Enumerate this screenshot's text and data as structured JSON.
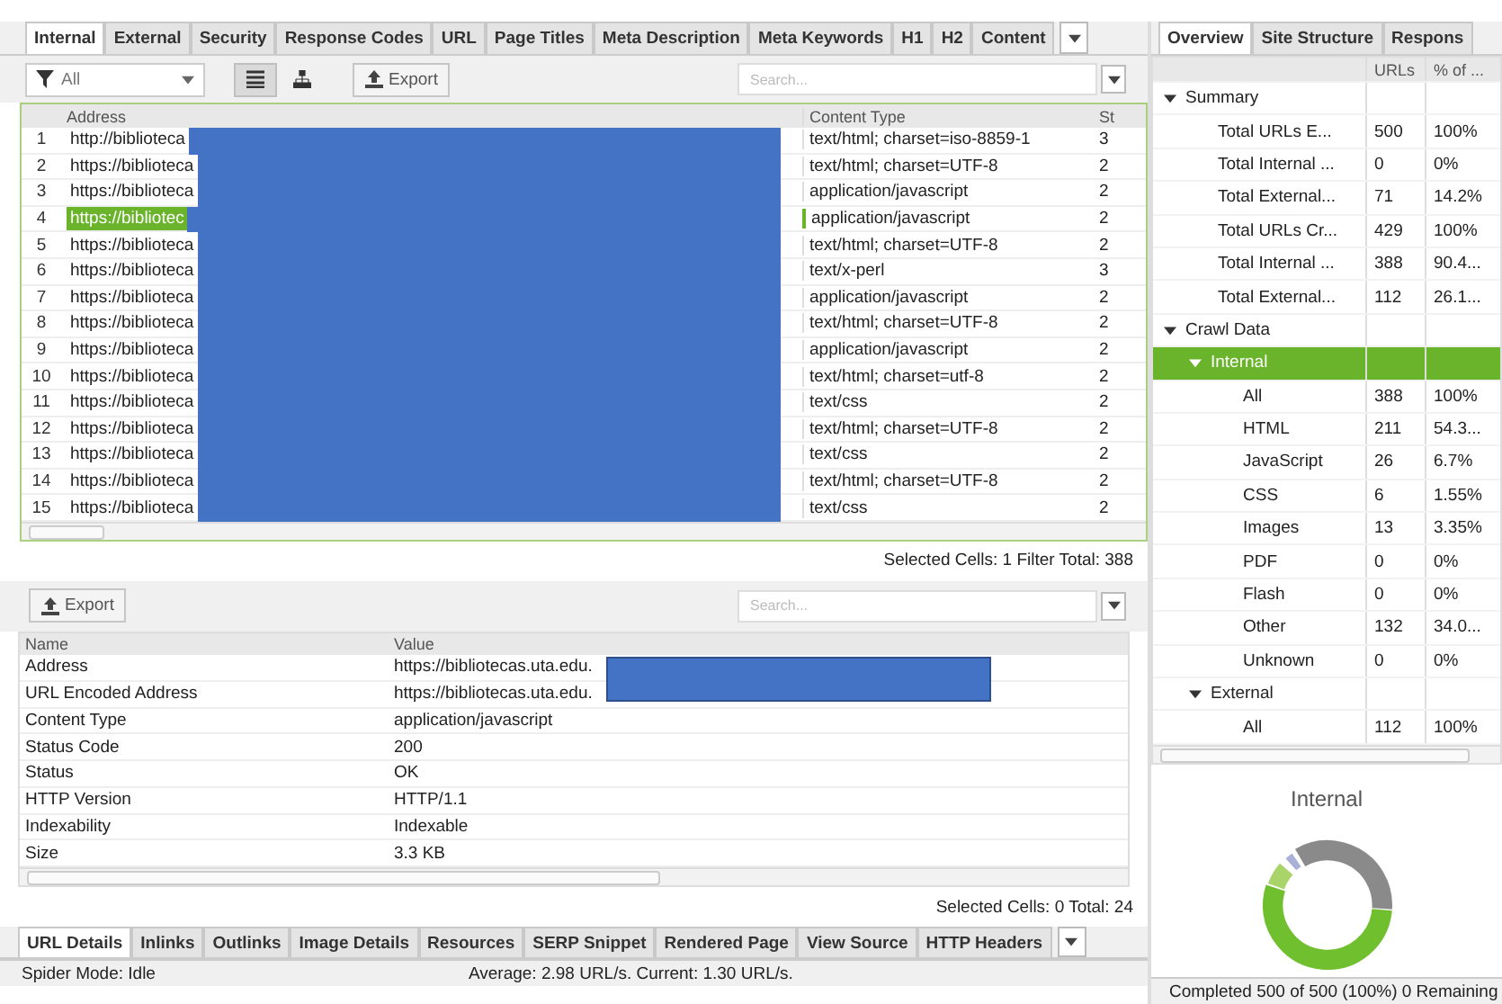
{
  "main_tabs": [
    {
      "label": "Internal",
      "selected": true
    },
    {
      "label": "External",
      "selected": false
    },
    {
      "label": "Security",
      "selected": false
    },
    {
      "label": "Response Codes",
      "selected": false
    },
    {
      "label": "URL",
      "selected": false
    },
    {
      "label": "Page Titles",
      "selected": false
    },
    {
      "label": "Meta Description",
      "selected": false
    },
    {
      "label": "Meta Keywords",
      "selected": false
    },
    {
      "label": "H1",
      "selected": false
    },
    {
      "label": "H2",
      "selected": false
    },
    {
      "label": "Content",
      "selected": false
    }
  ],
  "toolbar": {
    "filter": "All",
    "views": [
      {
        "kind": "list",
        "selected": true
      },
      {
        "kind": "tree",
        "selected": false
      }
    ],
    "export": "Export",
    "search": {
      "placeholder": "Search..."
    }
  },
  "table": {
    "columns": [
      "Address",
      "Content Type",
      "St"
    ],
    "rows": [
      {
        "index": "1",
        "address": "http://biblioteca",
        "content_type": "text/html; charset=iso-8859-1",
        "column_3": "3",
        "selected": false
      },
      {
        "index": "2",
        "address": "https://biblioteca",
        "content_type": "text/html; charset=UTF-8",
        "column_3": "2",
        "selected": false
      },
      {
        "index": "3",
        "address": "https://biblioteca",
        "content_type": "application/javascript",
        "column_3": "2",
        "selected": false
      },
      {
        "index": "4",
        "address": "https://bibliotec",
        "content_type": "application/javascript",
        "column_3": "2",
        "selected": true
      },
      {
        "index": "5",
        "address": "https://biblioteca",
        "content_type": "text/html; charset=UTF-8",
        "column_3": "2",
        "selected": false
      },
      {
        "index": "6",
        "address": "https://biblioteca",
        "content_type": "text/x-perl",
        "column_3": "3",
        "selected": false
      },
      {
        "index": "7",
        "address": "https://biblioteca",
        "content_type": "application/javascript",
        "column_3": "2",
        "selected": false
      },
      {
        "index": "8",
        "address": "https://biblioteca",
        "content_type": "text/html; charset=UTF-8",
        "column_3": "2",
        "selected": false
      },
      {
        "index": "9",
        "address": "https://biblioteca",
        "content_type": "application/javascript",
        "column_3": "2",
        "selected": false
      },
      {
        "index": "10",
        "address": "https://biblioteca",
        "content_type": "text/html; charset=utf-8",
        "column_3": "2",
        "selected": false
      },
      {
        "index": "11",
        "address": "https://biblioteca",
        "content_type": "text/css",
        "column_3": "2",
        "selected": false
      },
      {
        "index": "12",
        "address": "https://biblioteca",
        "content_type": "text/html; charset=UTF-8",
        "column_3": "2",
        "selected": false
      },
      {
        "index": "13",
        "address": "https://biblioteca",
        "content_type": "text/css",
        "column_3": "2",
        "selected": false
      },
      {
        "index": "14",
        "address": "https://biblioteca",
        "content_type": "text/html; charset=UTF-8",
        "column_3": "2",
        "selected": false
      },
      {
        "index": "15",
        "address": "https://biblioteca",
        "content_type": "text/css",
        "column_3": "2",
        "selected": false
      }
    ],
    "footer": "Selected Cells: 1  Filter Total: 388"
  },
  "details": {
    "export": "Export",
    "search": {
      "placeholder": "Search..."
    },
    "columns": [
      "Name",
      "Value"
    ],
    "rows": [
      {
        "name": "Address",
        "value": "https://bibliotecas.uta.edu."
      },
      {
        "name": "URL Encoded Address",
        "value": "https://bibliotecas.uta.edu."
      },
      {
        "name": "Content Type",
        "value": "application/javascript"
      },
      {
        "name": "Status Code",
        "value": "200"
      },
      {
        "name": "Status",
        "value": "OK"
      },
      {
        "name": "HTTP Version",
        "value": "HTTP/1.1"
      },
      {
        "name": "Indexability",
        "value": "Indexable"
      },
      {
        "name": "Size",
        "value": "3.3 KB"
      }
    ],
    "footer": "Selected Cells: 0  Total: 24"
  },
  "bottom_tabs": [
    {
      "label": "URL Details",
      "selected": true
    },
    {
      "label": "Inlinks",
      "selected": false
    },
    {
      "label": "Outlinks",
      "selected": false
    },
    {
      "label": "Image Details",
      "selected": false
    },
    {
      "label": "Resources",
      "selected": false
    },
    {
      "label": "SERP Snippet",
      "selected": false
    },
    {
      "label": "Rendered Page",
      "selected": false
    },
    {
      "label": "View Source",
      "selected": false
    },
    {
      "label": "HTTP Headers",
      "selected": false
    }
  ],
  "side_tabs": [
    {
      "label": "Overview",
      "selected": true
    },
    {
      "label": "Site Structure",
      "selected": false
    },
    {
      "label": "Respons",
      "selected": false
    }
  ],
  "overview": {
    "columns": [
      "URLs",
      "% of ..."
    ],
    "tree": [
      {
        "label": "Summary",
        "expanded": true,
        "selected": false,
        "children": [
          {
            "label": "Total URLs E...",
            "urls": "500",
            "percent": "100%",
            "selected": false
          },
          {
            "label": "Total Internal ...",
            "urls": "0",
            "percent": "0%",
            "selected": false
          },
          {
            "label": "Total External...",
            "urls": "71",
            "percent": "14.2%",
            "selected": false
          },
          {
            "label": "Total URLs Cr...",
            "urls": "429",
            "percent": "100%",
            "selected": false
          },
          {
            "label": "Total Internal ...",
            "urls": "388",
            "percent": "90.4...",
            "selected": false
          },
          {
            "label": "Total External...",
            "urls": "112",
            "percent": "26.1...",
            "selected": false
          }
        ]
      },
      {
        "label": "Crawl Data",
        "expanded": true,
        "selected": false,
        "children": [
          {
            "label": "Internal",
            "expanded": true,
            "selected": true,
            "children": [
              {
                "label": "All",
                "urls": "388",
                "percent": "100%",
                "selected": false
              },
              {
                "label": "HTML",
                "urls": "211",
                "percent": "54.3...",
                "selected": false
              },
              {
                "label": "JavaScript",
                "urls": "26",
                "percent": "6.7%",
                "selected": false
              },
              {
                "label": "CSS",
                "urls": "6",
                "percent": "1.55%",
                "selected": false
              },
              {
                "label": "Images",
                "urls": "13",
                "percent": "3.35%",
                "selected": false
              },
              {
                "label": "PDF",
                "urls": "0",
                "percent": "0%",
                "selected": false
              },
              {
                "label": "Flash",
                "urls": "0",
                "percent": "0%",
                "selected": false
              },
              {
                "label": "Other",
                "urls": "132",
                "percent": "34.0...",
                "selected": false
              },
              {
                "label": "Unknown",
                "urls": "0",
                "percent": "0%",
                "selected": false
              }
            ]
          },
          {
            "label": "External",
            "expanded": true,
            "selected": false,
            "children": [
              {
                "label": "All",
                "urls": "112",
                "percent": "100%",
                "selected": false
              }
            ]
          }
        ]
      }
    ]
  },
  "chart_title": "Internal",
  "status_bar": {
    "mode": "Spider Mode: Idle",
    "speed": "Average: 2.98 URL/s. Current: 1.30 URL/s.",
    "progress": "Completed 500 of 500 (100%) 0 Remaining"
  }
}
